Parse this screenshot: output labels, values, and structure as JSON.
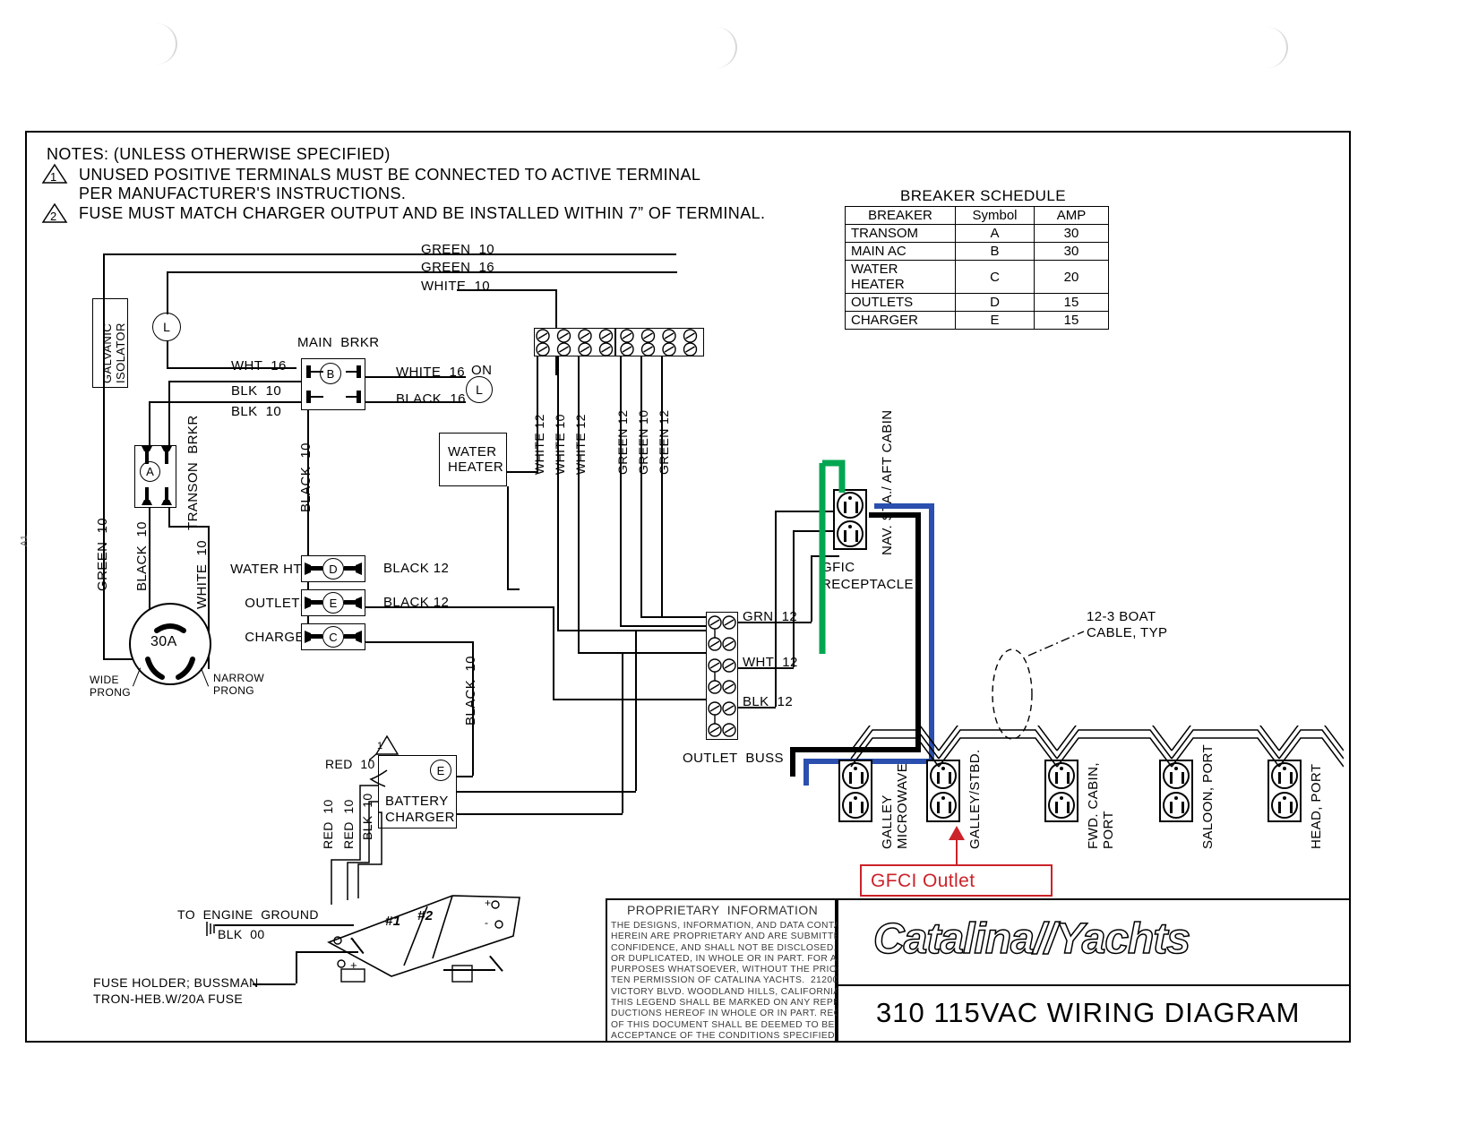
{
  "sheet": {
    "notes_header": "NOTES: (UNLESS OTHERWISE SPECIFIED)",
    "note_1": "UNUSED POSITIVE TERMINALS MUST BE CONNECTED TO ACTIVE TERMINAL",
    "note_1b": "PER MANUFACTURER'S INSTRUCTIONS.",
    "note_2": "FUSE MUST MATCH CHARGER OUTPUT AND BE INSTALLED WITHIN 7” OF TERMINAL.",
    "note_num_1": "1",
    "note_num_2": "2",
    "margin_mark": "A1"
  },
  "breaker_schedule": {
    "title": "BREAKER SCHEDULE",
    "headers": [
      "BREAKER",
      "Symbol",
      "AMP"
    ],
    "rows": [
      {
        "breaker": "TRANSOM",
        "symbol": "A",
        "amp": "30"
      },
      {
        "breaker": "MAIN AC",
        "symbol": "B",
        "amp": "30"
      },
      {
        "breaker": "WATER HEATER",
        "symbol": "C",
        "amp": "20"
      },
      {
        "breaker": "OUTLETS",
        "symbol": "D",
        "amp": "15"
      },
      {
        "breaker": "CHARGER",
        "symbol": "E",
        "amp": "15"
      }
    ]
  },
  "components": {
    "galvanic_isolator": "GALVANIC\nISOLATOR",
    "main_brkr": "MAIN  BRKR",
    "transon_brkr": "TRANSON  BRKR",
    "water_heater": "WATER\nHEATER",
    "battery_charger": "BATTERY\nCHARGER",
    "outlet_buss": "OUTLET  BUSS",
    "gfic_receptacle": "GFIC\nRECEPTACLE",
    "plug_rating": "30A",
    "wide_prong": "WIDE\nPRONG",
    "narrow_prong": "NARROW\nPRONG",
    "on_lamp": "ON",
    "lamp_symbol_l": "L",
    "lamp_symbol_iso": "L",
    "boat_cable": "12-3 BOAT\nCABLE, TYP",
    "to_engine_ground": "TO  ENGINE  GROUND",
    "blk00": "BLK  00",
    "fuse_holder": "FUSE HOLDER; BUSSMAN-\nTRON-HEB.W/20A FUSE",
    "battery_1": "#1",
    "battery_2": "#2"
  },
  "breaker_rows": [
    {
      "label": "WATER HTR",
      "symbol": "D",
      "wire": "BLACK 12"
    },
    {
      "label": "OUTLETS",
      "symbol": "E",
      "wire": "BLACK 12"
    },
    {
      "label": "CHARGER",
      "symbol": "C",
      "wire": ""
    }
  ],
  "wire_labels": {
    "green10_top": "GREEN  10",
    "green16_top": "GREEN  16",
    "white10_top": "WHITE  10",
    "wht16": "WHT  16",
    "blk10_a": "BLK  10",
    "blk10_b": "BLK  10",
    "white16": "WHITE  16",
    "black16": "BLACK  16",
    "green10_v": "GREEN  10",
    "black10_v": "BLACK  10",
    "white10_v": "WHITE  10",
    "black10_mid": "BLACK  10",
    "black10_charger": "BLACK  10",
    "red10_top": "RED  10",
    "red10_a": "RED  10",
    "red10_b": "RED  10",
    "blk10_c": "BLK  10",
    "bus_white12_a": "WHITE 12",
    "bus_white10": "WHITE 10",
    "bus_white12_b": "WHITE 12",
    "bus_green12_a": "GREEN 12",
    "bus_green10": "GREEN 10",
    "bus_green12_b": "GREEN 12",
    "grn12": "GRN  12",
    "wht12": "WHT  12",
    "blk12": "BLK  12"
  },
  "outlets": [
    {
      "name": "GALLEY\nMICROWAVE",
      "duplex": true
    },
    {
      "name": "GALLEY/STBD.",
      "duplex": true
    },
    {
      "name": "FWD. CABIN,\nPORT",
      "duplex": true
    },
    {
      "name": "SALOON, PORT",
      "duplex": true
    },
    {
      "name": "HEAD, PORT",
      "duplex": true
    }
  ],
  "nav_station_label": "NAV. STA./ AFT CABIN",
  "annotation": {
    "gfci_outlet": "GFCI Outlet",
    "color": "#e01b24"
  },
  "colors": {
    "green_wire": "#00a651",
    "black_wire": "#000000",
    "blue_wire": "#2a4fae",
    "annotation_red": "#cc2229"
  },
  "title_block": {
    "proprietary_title": "PROPRIETARY  INFORMATION",
    "proprietary_body": "THE DESIGNS, INFORMATION, AND DATA CONTAINED\nHEREIN ARE PROPRIETARY AND ARE SUBMITTED IN\nCONFIDENCE, AND SHALL NOT BE DISCLOSED, USED,\nOR DUPLICATED, IN WHOLE OR IN PART. FOR ANY\nPURPOSES WHATSOEVER, WITHOUT THE PRIOR WRIT-\nTEN PERMISSION OF CATALINA YACHTS.  21200\nVICTORY BLVD. WOODLAND HILLS, CALIFORNIA 91367\nTHIS LEGEND SHALL BE MARKED ON ANY REPRO-\nDUCTIONS HEREOF IN WHOLE OR IN PART. RECEIPT\nOF THIS DOCUMENT SHALL BE DEEMED TO BE AN\nACCEPTANCE OF THE CONDITIONS SPECIFIED HEREIN.",
    "company_logo": "Catalina//Yachts",
    "drawing_title": "310 115VAC WIRING DIAGRAM"
  }
}
